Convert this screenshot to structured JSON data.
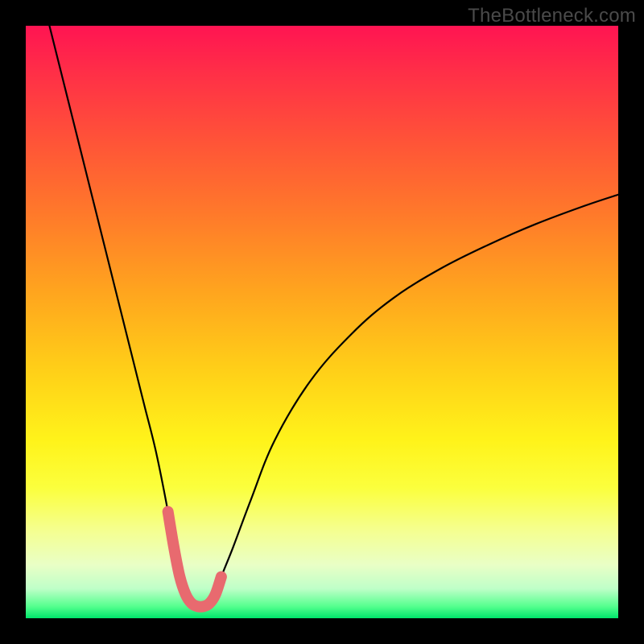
{
  "watermark": "TheBottleneck.com",
  "chart_data": {
    "type": "line",
    "title": "",
    "xlabel": "",
    "ylabel": "",
    "xlim": [
      0,
      100
    ],
    "ylim": [
      0,
      100
    ],
    "series": [
      {
        "name": "bottleneck-curve",
        "x": [
          4,
          6,
          8,
          10,
          12,
          14,
          16,
          18,
          20,
          22,
          24,
          25,
          26,
          27,
          28,
          29,
          30,
          31,
          32,
          33,
          35,
          38,
          42,
          48,
          55,
          62,
          70,
          78,
          86,
          94,
          100
        ],
        "values": [
          100,
          92,
          84,
          76,
          68,
          60,
          52,
          44,
          36,
          28,
          18,
          12,
          7,
          4,
          2.5,
          2,
          2,
          2.5,
          4,
          7,
          12,
          20,
          30,
          40,
          48,
          54,
          59,
          63,
          66.5,
          69.5,
          71.5
        ]
      },
      {
        "name": "highlight-segment",
        "x": [
          24,
          25,
          26,
          27,
          28,
          29,
          30,
          31,
          32,
          33
        ],
        "values": [
          18,
          12,
          7,
          4,
          2.5,
          2,
          2,
          2.5,
          4,
          7
        ]
      }
    ],
    "colors": {
      "curve": "#000000",
      "highlight": "#e86a6f"
    }
  }
}
